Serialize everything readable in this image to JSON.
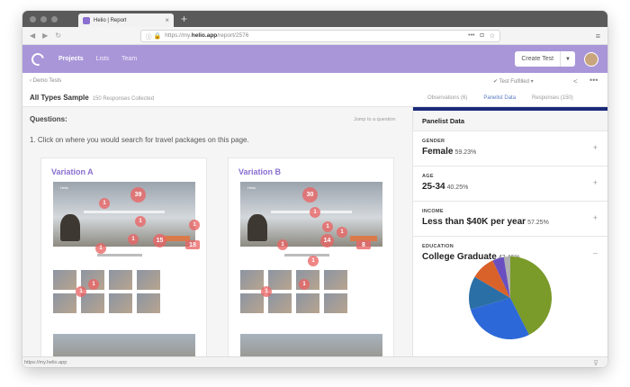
{
  "browser": {
    "tab_title": "Helio | Report",
    "tab_close": "×",
    "new_tab": "+",
    "url_prefix": "https://my.",
    "url_domain": "helio.app",
    "url_path": "/report/2576",
    "status_url": "https://my.helio.app"
  },
  "nav": {
    "links": [
      "Projects",
      "Lists",
      "Team"
    ],
    "create_label": "Create Test"
  },
  "subheader": {
    "back_label": "‹ Demo Tests",
    "title": "All Types Sample",
    "responses": "150 Responses Collected",
    "filter_label": "✔ Test Fulfilled ▾",
    "tabs": [
      "Observations (6)",
      "Panelist Data",
      "Responses (150)"
    ]
  },
  "questions": {
    "heading": "Questions:",
    "jump": "Jump to a question",
    "question": "1.  Click on where you would search for travel packages on this page."
  },
  "variations": [
    {
      "title": "Variation A",
      "hero_brand": "Helio",
      "hotspots": [
        {
          "label": "39"
        },
        {
          "label": "1"
        },
        {
          "label": "1"
        },
        {
          "label": "1"
        },
        {
          "label": "1"
        },
        {
          "label": "15"
        },
        {
          "label": "18"
        },
        {
          "label": "1"
        },
        {
          "label": "1"
        },
        {
          "label": "1"
        }
      ]
    },
    {
      "title": "Variation B",
      "hero_brand": "Helio",
      "hotspots": [
        {
          "label": "30"
        },
        {
          "label": "1"
        },
        {
          "label": "1"
        },
        {
          "label": "1"
        },
        {
          "label": "14"
        },
        {
          "label": "8"
        },
        {
          "label": "1"
        },
        {
          "label": "1"
        },
        {
          "label": "1"
        },
        {
          "label": "1"
        }
      ]
    }
  ],
  "panel": {
    "heading": "Panelist Data",
    "sections": [
      {
        "label": "GENDER",
        "value": "Female",
        "pct": "59.23%",
        "toggle": "+"
      },
      {
        "label": "AGE",
        "value": "25-34",
        "pct": "40.25%",
        "toggle": "+"
      },
      {
        "label": "INCOME",
        "value": "Less than $40K per year",
        "pct": "57.25%",
        "toggle": "+"
      },
      {
        "label": "EDUCATION",
        "value": "College Graduate",
        "pct": "42.46%",
        "toggle": "–"
      }
    ]
  },
  "chart_data": {
    "type": "pie",
    "values": [
      42.46,
      28,
      13,
      9.5,
      4.5,
      2.5
    ],
    "colors": [
      "#7a9a2a",
      "#2d68d8",
      "#2a6fa5",
      "#d9622b",
      "#6a4fc0",
      "#b0b0b0"
    ]
  }
}
